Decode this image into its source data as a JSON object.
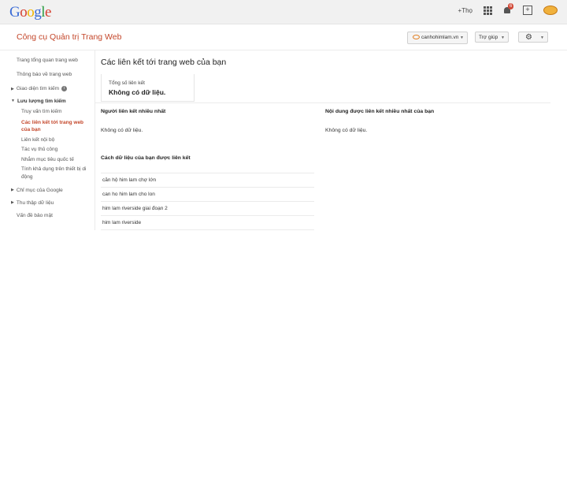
{
  "topbar": {
    "logo": [
      "G",
      "o",
      "o",
      "g",
      "l",
      "e"
    ],
    "logo_colors": [
      "#3b6cd6",
      "#d6402f",
      "#f0b400",
      "#3b6cd6",
      "#2c9c42",
      "#d6402f"
    ],
    "plus_link": "+Thọ",
    "notification_count": "6"
  },
  "header": {
    "app_title": "Công cụ Quản trị Trang Web",
    "site_selector": "canhohimlam.vn",
    "help_label": "Trợ giúp"
  },
  "sidebar": {
    "items": [
      {
        "label": "Trang tổng quan trang web"
      },
      {
        "label": "Thông báo về trang web"
      },
      {
        "label": "Giao diện tìm kiếm"
      },
      {
        "label": "Lưu lượng tìm kiếm"
      },
      {
        "label": "Truy vấn tìm kiếm"
      },
      {
        "label": "Các liên kết tới trang web của bạn"
      },
      {
        "label": "Liên kết nội bộ"
      },
      {
        "label": "Tác vụ thủ công"
      },
      {
        "label": "Nhắm mục tiêu quốc tế"
      },
      {
        "label": "Tính khả dụng trên thiết bị di động"
      },
      {
        "label": "Chỉ mục của Google"
      },
      {
        "label": "Thu thập dữ liệu"
      },
      {
        "label": "Vấn đề bảo mật"
      }
    ]
  },
  "main": {
    "page_title": "Các liên kết tới trang web của bạn",
    "total_links_label": "Tổng số liên kết",
    "total_links_value": "Không có dữ liệu.",
    "top_linkers_title": "Người liên kết nhiều nhất",
    "top_linkers_value": "Không có dữ liệu.",
    "top_content_title": "Nội dung được liên kết nhiều nhất của bạn",
    "top_content_value": "Không có dữ liệu.",
    "anchors_title": "Cách dữ liệu của bạn được liên kết",
    "anchors": [
      "căn hộ him lam chợ lớn",
      "can ho him lam cho lon",
      "him lam riverside giai đoạn 2",
      "him lam riverside"
    ]
  }
}
